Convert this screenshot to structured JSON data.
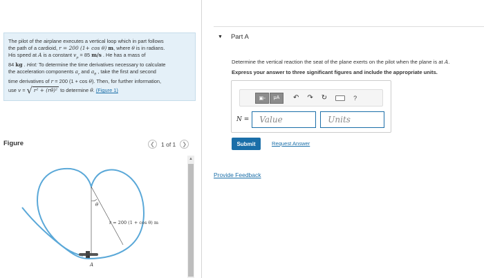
{
  "problem": {
    "line1": "The pilot of the airplane executes a vertical loop which in part follows",
    "l2_a": "the path of a cardioid, ",
    "l2_eq": "r = 200 (1+ cos θ)",
    "l2_unit": "m",
    "l2_b": ", where ",
    "l2_theta": "θ",
    "l2_c": " is in radians.",
    "l3_a": "His speed at ",
    "l3_A": "A",
    "l3_b": " is a constant ",
    "l3_vp": "v",
    "l3_p": "p",
    "l3_c": " = 85 ",
    "l3_unit": "m/s",
    "l3_d": " . He has a mass of",
    "l4_mass": "84",
    "l4_kg": "kg",
    "l4_hint": "Hint:",
    "l4_b": " To determine the time derivatives necessary to calculate",
    "l5_a": "the acceleration components ",
    "l5_ar": "a",
    "l5_r": "r",
    "l5_and": " and ",
    "l5_at": "a",
    "l5_t": "θ",
    "l5_b": " , take the first and second",
    "l6_a": "time derivatives of ",
    "l6_eq": "r",
    "l6_b": " = 200 (1 + cos ",
    "l6_theta": "θ",
    "l6_c": "). Then, for further information,",
    "l7_a": "use ",
    "l7_v": "v",
    "l7_eq": " = ",
    "l7_root": "√",
    "l7_expr": "r² + (rθ̇)²",
    "l7_b": " to determine ",
    "l7_thetadot": "θ̇",
    "l7_c": ". ",
    "figure_link": "(Figure 1)"
  },
  "figure": {
    "label": "Figure",
    "pager_text": "1 of 1",
    "theta_label": "θ",
    "r_label": "r = 200 (1 + cos θ) m",
    "a_label": "A"
  },
  "part": {
    "title": "Part A"
  },
  "question": {
    "line1_a": "Determine the vertical reaction the seat of the plane exerts on the pilot when the plane is at ",
    "line1_A": "A",
    "line1_b": ".",
    "line2": "Express your answer to three significant figures and include the appropriate units."
  },
  "answer": {
    "label_N": "N",
    "label_eq": " =",
    "value_placeholder": "Value",
    "units_placeholder": "Units",
    "mu_label": "μA",
    "help": "?"
  },
  "buttons": {
    "submit": "Submit",
    "request": "Request Answer",
    "feedback": "Provide Feedback"
  },
  "colors": {
    "accent": "#1a6ea8",
    "problem_bg": "#e4f0f8",
    "curve": "#5aa8d8"
  }
}
